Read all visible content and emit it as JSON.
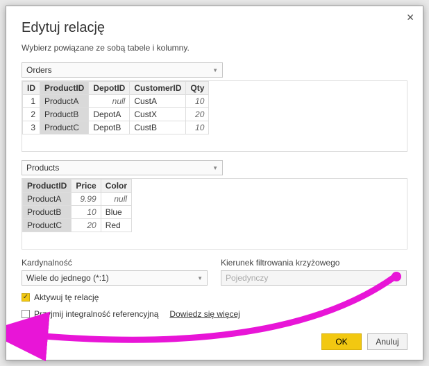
{
  "dialog": {
    "title": "Edytuj relację",
    "subtitle": "Wybierz powiązane ze sobą tabele i kolumny.",
    "close": "✕"
  },
  "table1": {
    "name": "Orders",
    "columns": [
      "ID",
      "ProductID",
      "DepotID",
      "CustomerID",
      "Qty"
    ],
    "selectedCol": 1,
    "rows": [
      {
        "ID": "1",
        "ProductID": "ProductA",
        "DepotID": "null",
        "CustomerID": "CustA",
        "Qty": "10",
        "DepotNull": true
      },
      {
        "ID": "2",
        "ProductID": "ProductB",
        "DepotID": "DepotA",
        "CustomerID": "CustX",
        "Qty": "20"
      },
      {
        "ID": "3",
        "ProductID": "ProductC",
        "DepotID": "DepotB",
        "CustomerID": "CustB",
        "Qty": "10"
      }
    ]
  },
  "table2": {
    "name": "Products",
    "columns": [
      "ProductID",
      "Price",
      "Color"
    ],
    "selectedCol": 0,
    "rows": [
      {
        "ProductID": "ProductA",
        "Price": "9.99",
        "Color": "null",
        "ColorNull": true
      },
      {
        "ProductID": "ProductB",
        "Price": "10",
        "Color": "Blue"
      },
      {
        "ProductID": "ProductC",
        "Price": "20",
        "Color": "Red"
      }
    ]
  },
  "cardinality": {
    "label": "Kardynalność",
    "value": "Wiele do jednego (*:1)"
  },
  "filterDir": {
    "label": "Kierunek filtrowania krzyżowego",
    "value": "Pojedynczy"
  },
  "activate": {
    "label": "Aktywuj tę relację",
    "checked": true
  },
  "referential": {
    "label": "Przyjmij integralność referencyjną",
    "checked": false,
    "learnMore": "Dowiedz się więcej"
  },
  "buttons": {
    "ok": "OK",
    "cancel": "Anuluj"
  }
}
